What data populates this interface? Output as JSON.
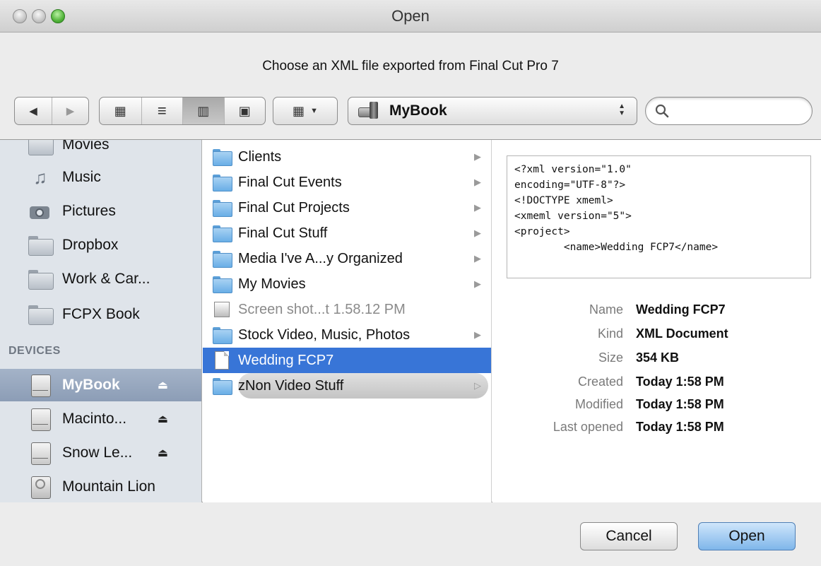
{
  "window": {
    "title": "Open"
  },
  "prompt": "Choose an XML file exported from Final Cut Pro 7",
  "toolbar": {
    "back_icon": "◀",
    "forward_icon": "▶",
    "icon_view": "▦",
    "list_view": "≡",
    "column_view": "▥",
    "coverflow_view": "▣",
    "arrange_icon": "▦",
    "arrange_chevron": "▼",
    "location": "MyBook",
    "search_placeholder": ""
  },
  "sidebar": {
    "places": [
      {
        "label": "Movies",
        "icon": "folder-icon"
      },
      {
        "label": "Music",
        "icon": "music-icon"
      },
      {
        "label": "Pictures",
        "icon": "camera-icon"
      },
      {
        "label": "Dropbox",
        "icon": "folder-icon"
      },
      {
        "label": "Work & Car...",
        "icon": "folder-icon"
      },
      {
        "label": "FCPX Book",
        "icon": "folder-icon"
      }
    ],
    "devices_header": "DEVICES",
    "devices": [
      {
        "label": "MyBook",
        "eject": "⏏"
      },
      {
        "label": "Macinto...",
        "eject": "⏏"
      },
      {
        "label": "Snow Le...",
        "eject": "⏏"
      },
      {
        "label": "Mountain Lion"
      }
    ]
  },
  "files": [
    {
      "name": "Clients",
      "arrow": "▶"
    },
    {
      "name": "Final Cut Events",
      "arrow": "▶"
    },
    {
      "name": "Final Cut Projects",
      "arrow": "▶"
    },
    {
      "name": "Final Cut Stuff",
      "arrow": "▶"
    },
    {
      "name": "Media I've A...y Organized",
      "arrow": "▶"
    },
    {
      "name": "My Movies",
      "arrow": "▶"
    },
    {
      "name": "Screen shot...t 1.58.12 PM"
    },
    {
      "name": "Stock Video, Music, Photos",
      "arrow": "▶"
    },
    {
      "name": "Wedding FCP7"
    },
    {
      "name": "zNon Video Stuff",
      "arrow": "▷"
    }
  ],
  "preview": {
    "xml_lines": [
      "<?xml version=\"1.0\"",
      "encoding=\"UTF-8\"?>",
      "<!DOCTYPE xmeml>",
      "<xmeml version=\"5\">",
      "<project>",
      "        <name>Wedding FCP7</name>"
    ],
    "info": [
      {
        "key": "Name",
        "value": "Wedding FCP7"
      },
      {
        "key": "Kind",
        "value": "XML Document"
      },
      {
        "key": "Size",
        "value": "354 KB"
      },
      {
        "key": "Created",
        "value": "Today 1:58 PM"
      },
      {
        "key": "Modified",
        "value": "Today 1:58 PM"
      },
      {
        "key": "Last opened",
        "value": "Today 1:58 PM"
      }
    ]
  },
  "buttons": {
    "cancel": "Cancel",
    "open": "Open"
  },
  "colors": {
    "selection": "#3875d7",
    "sidebar_bg": "#dfe4ea",
    "sidebar_selected": "#8c9db6",
    "default_button": "#7fb6ea"
  }
}
